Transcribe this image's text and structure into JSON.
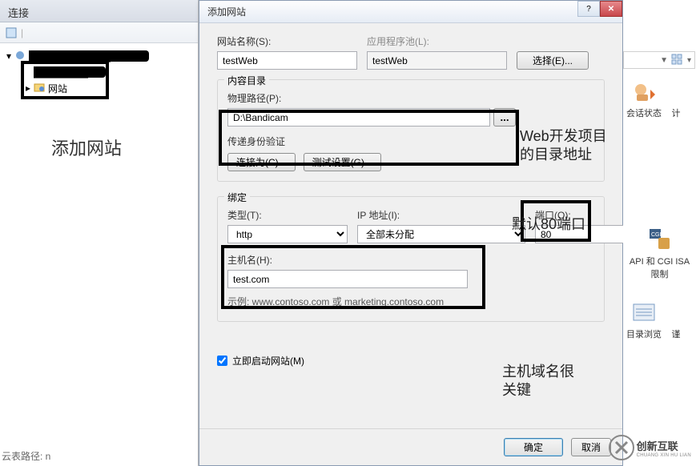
{
  "left": {
    "header": "连接",
    "tree": {
      "root_redacted": "████████████",
      "site_parent_redacted": "████████",
      "site_node": "网站"
    },
    "annotation": "添加网站"
  },
  "dialog": {
    "title": "添加网站",
    "site_name_label": "网站名称(S):",
    "site_name_value": "testWeb",
    "app_pool_label": "应用程序池(L):",
    "app_pool_value": "testWeb",
    "select_btn": "选择(E)...",
    "content_group": "内容目录",
    "physical_path_label": "物理路径(P):",
    "physical_path_value": "D:\\Bandicam",
    "browse_btn": "...",
    "passthrough_label": "传递身份验证",
    "connect_as_btn": "连接为(C)...",
    "test_settings_btn": "测试设置(G)...",
    "binding_group": "绑定",
    "type_label": "类型(T):",
    "type_value": "http",
    "ip_label": "IP 地址(I):",
    "ip_value": "全部未分配",
    "port_label": "端口(O):",
    "port_value": "80",
    "host_label": "主机名(H):",
    "host_value": "test.com",
    "host_example": "示例: www.contoso.com 或 marketing.contoso.com",
    "start_now_label": "立即启动网站(M)",
    "ok_btn": "确定",
    "cancel_btn": "取消"
  },
  "annotations": {
    "ann1": "Web开发项目的目录地址",
    "ann2": "默认80端口",
    "ann3": "主机域名很关键"
  },
  "right": {
    "item1": "会话状态",
    "item1b": "计",
    "item2": "API 和 CGI ISA限制",
    "item3": "目录浏览",
    "item3b": "谨"
  },
  "logo": {
    "text1": "创新互联",
    "text2": "CHUANG XIN HU LIAN"
  },
  "footer_text": "云表路径: n"
}
